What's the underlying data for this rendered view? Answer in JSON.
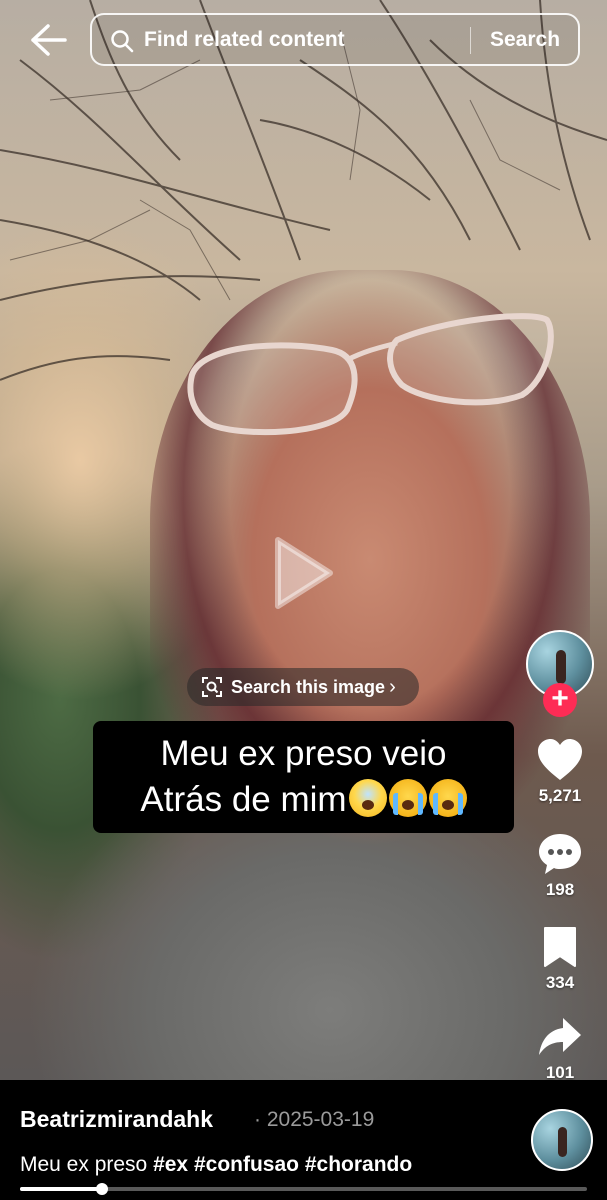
{
  "topbar": {
    "search_placeholder": "Find related content",
    "search_button": "Search"
  },
  "video": {
    "search_image_label": "Search this image",
    "caption_line1": "Meu ex preso veio",
    "caption_line2": "Atrás de mim"
  },
  "actions": {
    "likes": "5,271",
    "comments": "198",
    "saves": "334",
    "shares": "101"
  },
  "post": {
    "author": "Beatrizmirandahk",
    "separator": "·",
    "date": "2025-03-19",
    "description_text": "Meu ex preso",
    "hashtags": [
      "#ex",
      "#confusao",
      "#chorando"
    ]
  },
  "playback": {
    "progress_fraction": 0.145
  },
  "colors": {
    "follow": "#fe2c55",
    "background": "#000000",
    "text": "#ffffff",
    "date": "#9a9a9a"
  }
}
